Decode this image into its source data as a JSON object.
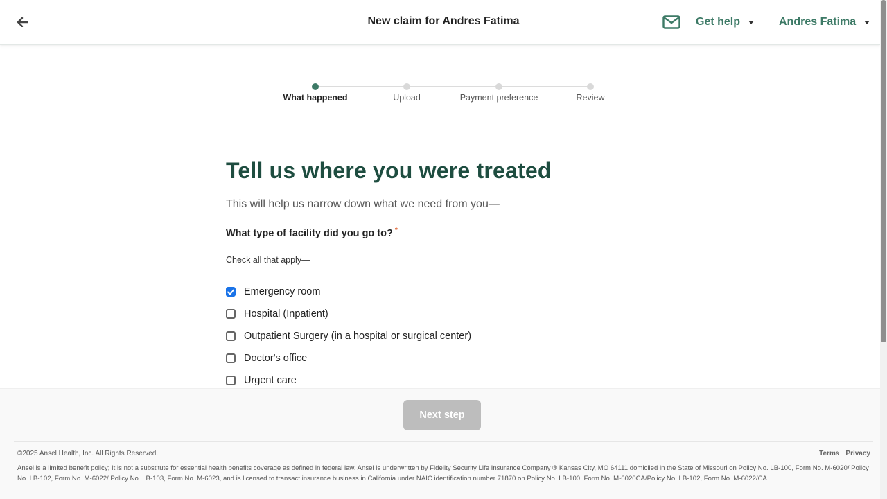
{
  "header": {
    "title": "New claim for Andres Fatima",
    "help_label": "Get help",
    "user_name": "Andres Fatima",
    "accent_color": "#3d7a66"
  },
  "stepper": {
    "steps": [
      {
        "label": "What happened",
        "active": true
      },
      {
        "label": "Upload",
        "active": false
      },
      {
        "label": "Payment preference",
        "active": false
      },
      {
        "label": "Review",
        "active": false
      }
    ]
  },
  "main": {
    "heading": "Tell us where you were treated",
    "subheading": "This will help us narrow down what we need from you—",
    "question": "What type of facility did you go to?",
    "required_marker": "*",
    "hint": "Check all that apply—",
    "options": [
      {
        "label": "Emergency room",
        "checked": true
      },
      {
        "label": "Hospital (Inpatient)",
        "checked": false
      },
      {
        "label": "Outpatient Surgery (in a hospital or surgical center)",
        "checked": false
      },
      {
        "label": "Doctor's office",
        "checked": false
      },
      {
        "label": "Urgent care",
        "checked": false
      }
    ]
  },
  "footer": {
    "next_label": "Next step",
    "copyright": "©2025 Ansel Health, Inc. All Rights Reserved.",
    "terms": "Terms",
    "privacy": "Privacy",
    "disclaimer": "Ansel is a limited benefit policy; It is not a substitute for essential health benefits coverage as defined in federal law. Ansel is underwritten by Fidelity Security Life Insurance Company ® Kansas City, MO 64111 domiciled in the State of Missouri on Policy No. LB-100, Form No. M-6020/ Policy No. LB-102, Form No. M-6022/ Policy No. LB-103, Form No. M-6023, and is licensed to transact insurance business in California under NAIC identification number 71870 on Policy No. LB-100, Form No. M-6020CA/Policy No. LB-102, Form No. M-6022/CA."
  }
}
